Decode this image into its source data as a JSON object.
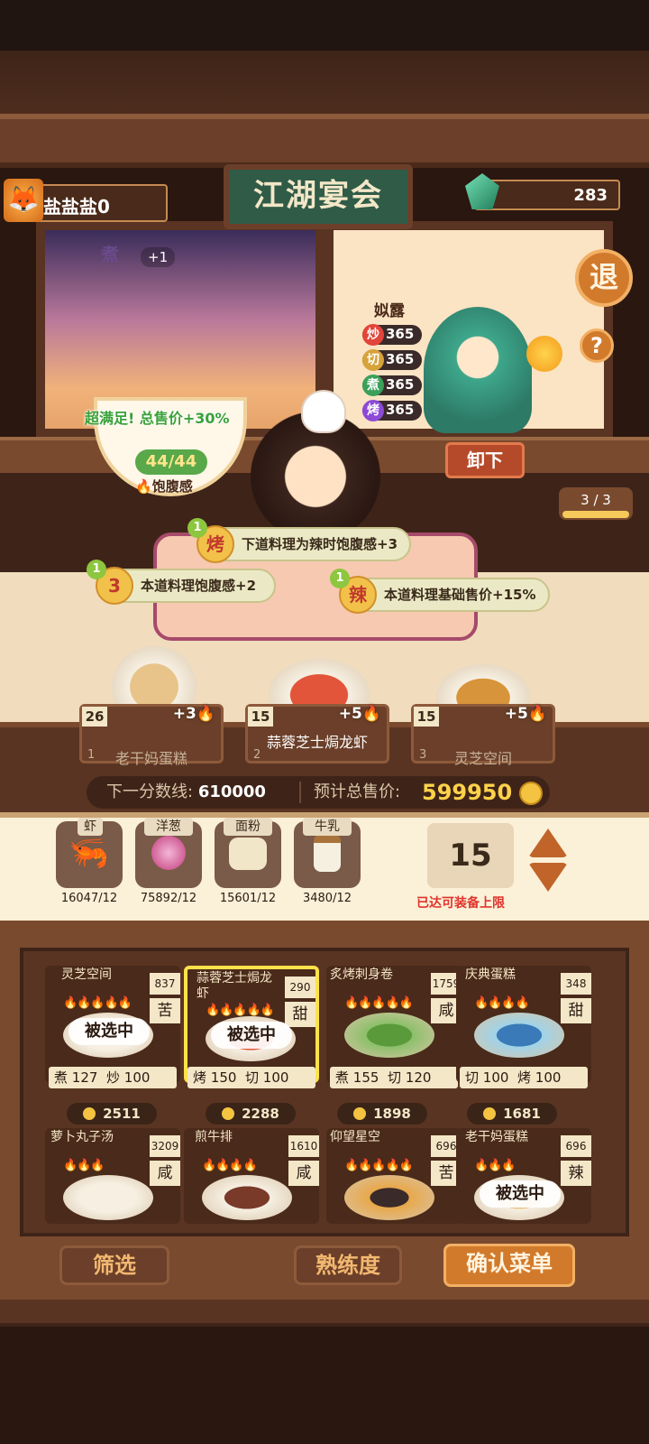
{
  "player": {
    "name": "盐盐盐0"
  },
  "banner": {
    "title": "江湖宴会"
  },
  "currency": {
    "gems": "283"
  },
  "buttons": {
    "exit": "退",
    "help": "?",
    "unload": "卸下",
    "filter": "筛选",
    "proficiency": "熟练度",
    "confirm": "确认菜单"
  },
  "cook_bonus": {
    "method": "煮",
    "value": "+1"
  },
  "chef": {
    "name": "姒露",
    "skills": [
      {
        "icon": "炒",
        "value": "365",
        "color": "#e2453a"
      },
      {
        "icon": "切",
        "value": "365",
        "color": "#d7a23a"
      },
      {
        "icon": "煮",
        "value": "365",
        "color": "#3aa05a"
      },
      {
        "icon": "烤",
        "value": "365",
        "color": "#8c4ad7"
      }
    ],
    "slot_count": "3 / 3"
  },
  "satiety": {
    "banner": "超满足! 总售价+30%",
    "count": "44/44",
    "label": "饱腹感"
  },
  "bonuses": [
    {
      "level": "1",
      "icon": "烤",
      "text": "下道料理为辣时饱腹感+3"
    },
    {
      "level": "1",
      "icon": "3",
      "text": "本道料理饱腹感+2"
    },
    {
      "level": "1",
      "icon": "辣",
      "text": "本道料理基础售价+15%"
    }
  ],
  "selected_dishes": [
    {
      "qty": "26",
      "slot": "1",
      "name": "老干妈蛋糕",
      "bonus": "+3"
    },
    {
      "qty": "15",
      "slot": "2",
      "name": "蒜蓉芝士焗龙虾",
      "bonus": "+5"
    },
    {
      "qty": "15",
      "slot": "3",
      "name": "灵芝空间",
      "bonus": "+5"
    }
  ],
  "score": {
    "next_label": "下一分数线:",
    "next_value": "610000",
    "total_label": "预计总售价:",
    "total_value": "599950"
  },
  "ingredients": [
    {
      "name": "虾",
      "count": "16047/12",
      "icon": "shrimp-icon"
    },
    {
      "name": "洋葱",
      "count": "75892/12",
      "icon": "onion-icon"
    },
    {
      "name": "面粉",
      "count": "15601/12",
      "icon": "flour-icon"
    },
    {
      "name": "牛乳",
      "count": "3480/12",
      "icon": "milk-icon"
    }
  ],
  "equip": {
    "count": "15",
    "message": "已达可装备上限"
  },
  "recipes": [
    {
      "name": "灵芝空间",
      "price": "837",
      "flavor": "苦",
      "fires": "🔥🔥🔥🔥🔥",
      "selected": "被选中",
      "skill1": "煮",
      "v1": "127",
      "skill2": "炒",
      "v2": "100",
      "coin": "2511"
    },
    {
      "name": "蒜蓉芝士焗龙虾",
      "price": "290",
      "flavor": "甜",
      "fires": "🔥🔥🔥🔥🔥",
      "selected": "被选中",
      "skill1": "烤",
      "v1": "150",
      "skill2": "切",
      "v2": "100",
      "coin": "2288"
    },
    {
      "name": "炙烤刺身卷",
      "price": "1759",
      "flavor": "咸",
      "fires": "🔥🔥🔥🔥🔥",
      "selected": "",
      "skill1": "煮",
      "v1": "155",
      "skill2": "切",
      "v2": "120",
      "coin": "1898"
    },
    {
      "name": "庆典蛋糕",
      "price": "348",
      "flavor": "甜",
      "fires": "🔥🔥🔥🔥",
      "selected": "",
      "skill1": "切",
      "v1": "100",
      "skill2": "烤",
      "v2": "100",
      "coin": "1681"
    },
    {
      "name": "萝卜丸子汤",
      "price": "3209",
      "flavor": "咸",
      "fires": "🔥🔥🔥",
      "selected": ""
    },
    {
      "name": "煎牛排",
      "price": "1610",
      "flavor": "咸",
      "fires": "🔥🔥🔥🔥",
      "selected": ""
    },
    {
      "name": "仰望星空",
      "price": "696",
      "flavor": "苦",
      "fires": "🔥🔥🔥🔥🔥",
      "selected": ""
    },
    {
      "name": "老干妈蛋糕",
      "price": "696",
      "flavor": "辣",
      "fires": "🔥🔥🔥",
      "selected": "被选中"
    }
  ]
}
